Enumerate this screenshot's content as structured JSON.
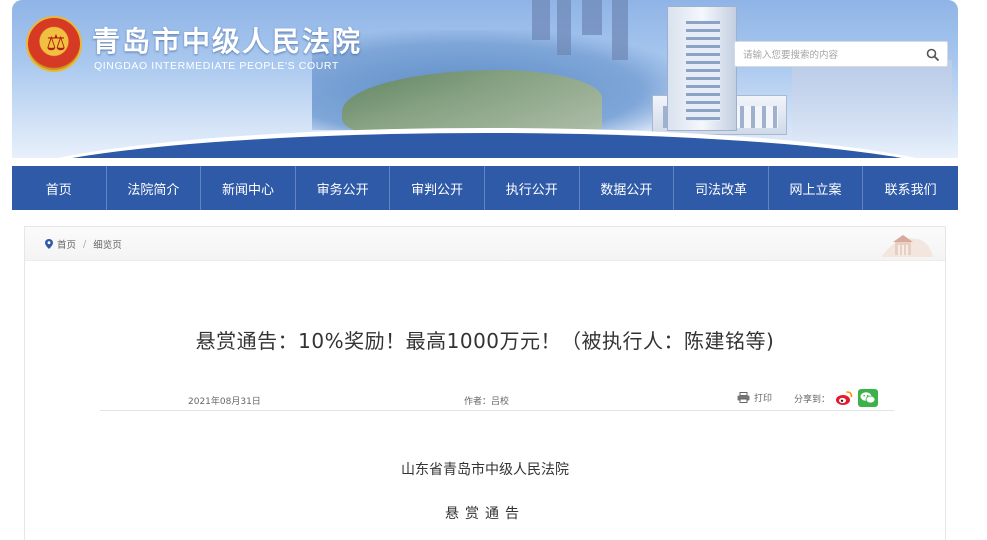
{
  "header": {
    "site_title": "青岛市中级人民法院",
    "site_subtitle": "QINGDAO INTERMEDIATE PEOPLE'S COURT",
    "search_placeholder": "请输入您要搜索的内容"
  },
  "nav": {
    "items": [
      {
        "label": "首页"
      },
      {
        "label": "法院简介"
      },
      {
        "label": "新闻中心"
      },
      {
        "label": "审务公开"
      },
      {
        "label": "审判公开"
      },
      {
        "label": "执行公开"
      },
      {
        "label": "数据公开"
      },
      {
        "label": "司法改革"
      },
      {
        "label": "网上立案"
      },
      {
        "label": "联系我们"
      }
    ]
  },
  "breadcrumb": {
    "home": "首页",
    "separator": "/",
    "current": "细览页"
  },
  "article": {
    "title": "悬赏通告：10%奖励！最高1000万元！（被执行人：陈建铭等)",
    "date": "2021年08月31日",
    "author": "作者：吕校",
    "print_label": "打印",
    "share_label": "分享到：",
    "body_line1": "山东省青岛市中级人民法院",
    "body_line2": "悬赏通告"
  },
  "icons": {
    "location": "location-pin-icon",
    "search": "search-icon",
    "print": "printer-icon",
    "weibo": "weibo-icon",
    "wechat": "wechat-icon"
  },
  "colors": {
    "nav_bg": "#2f5aa8",
    "weibo": "#e6162d",
    "wechat": "#3bb34a"
  }
}
